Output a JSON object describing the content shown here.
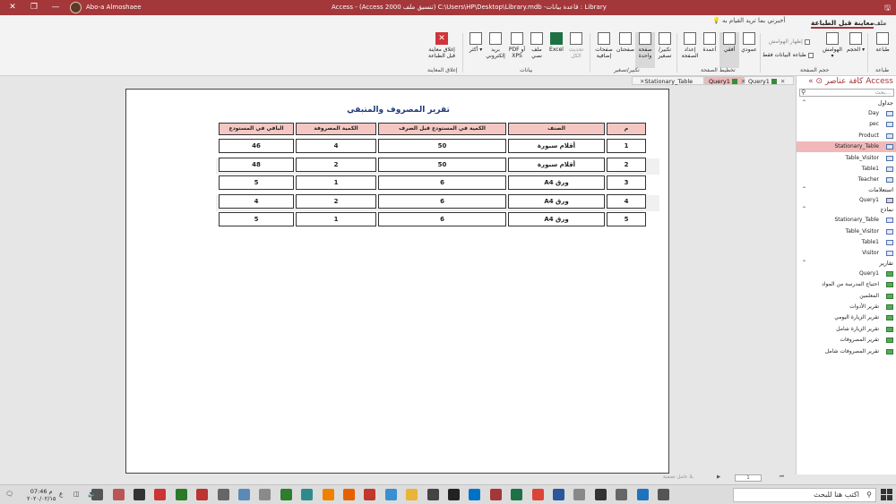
{
  "window": {
    "title": "Library : قاعدة بيانات- C:\\Users\\HP\\Desktop\\Library.mdb (تنسيق ملف Access 2000) - Access",
    "user": "Abo-a Almoshaee",
    "qa_icon": "save-icon"
  },
  "ribbon_tabs": {
    "file": "ملف",
    "print_preview": "معاينة قبل الطباعة",
    "tell_me": "أخبرني بما تريد القيام به"
  },
  "ribbon": {
    "print": "طباعة",
    "size": "الحجم",
    "margins": "الهوامش",
    "show_margins": "إظهار الهوامش",
    "print_data_only": "طباعة البيانات فقط",
    "portrait": "عمودي",
    "landscape": "أفقي",
    "columns": "أعمدة",
    "page_setup": "إعداد الصفحة",
    "zoom": "تكبير/ تصغير",
    "one_page": "صفحة واحدة",
    "two_pages": "صفحتان",
    "more_pages": "صفحات إضافية",
    "refresh_all": "تحديث الكل",
    "excel": "Excel",
    "text_file": "ملف نصي",
    "pdf_xps": "PDF أو XPS",
    "email": "بريد إلكتروني",
    "more": "أكثر",
    "close_preview": "إغلاق معاينة قبل الطباعة",
    "group_print": "طباعة",
    "group_page_size": "حجم الصفحة",
    "group_page_layout": "تخطيط الصفحة",
    "group_zoom": "تكبير/تصغير",
    "group_data": "بيانات",
    "group_close": "إغلاق المعاينة"
  },
  "doc_tabs": [
    {
      "label": "Query1"
    },
    {
      "label": "Query1"
    },
    {
      "label": "Stationary_Table"
    }
  ],
  "nav_pane": {
    "title": "كافة عناصر Access",
    "search_placeholder": "بحث...",
    "sections": {
      "tables": "جداول",
      "queries": "استعلامات",
      "forms": "نماذج",
      "reports": "تقارير"
    },
    "tables": [
      "Day",
      "pec",
      "Product",
      "Stationary_Table",
      "Table_Visitor",
      "Table1",
      "Teacher"
    ],
    "queries": [
      "Query1"
    ],
    "forms": [
      "Stationary_Table",
      "Table_Visitor",
      "Table1",
      "Visitor"
    ],
    "reports": [
      "Query1",
      "احتياج المدرسة من المواد",
      "المعلمين",
      "تقرير الأدوات",
      "تقرير الزيارة اليومي",
      "تقرير الزيارة شامل",
      "تقرير المصروفات",
      "تقرير المصروفات شامل"
    ]
  },
  "report": {
    "title": "تقرير المصروف والمتبقي",
    "headers": [
      "م",
      "الصنف",
      "الكمية في المستودع قبل الصرف",
      "الكمية المصروفة",
      "الباقي في المستودع"
    ],
    "rows": [
      [
        "1",
        "أقلام سبورة",
        "50",
        "4",
        "46"
      ],
      [
        "2",
        "أقلام سبورة",
        "50",
        "2",
        "48"
      ],
      [
        "3",
        "ورق A4",
        "6",
        "1",
        "5"
      ],
      [
        "4",
        "ورق A4",
        "6",
        "2",
        "4"
      ],
      [
        "5",
        "ورق A4",
        "6",
        "1",
        "5"
      ]
    ]
  },
  "status": {
    "page": "1",
    "filter": "بلا عامل تصفية"
  },
  "taskbar": {
    "search_placeholder": "اكتب هنا للبحث",
    "time": "م 07:46",
    "date": "٢٠٢٠/٠٢/١٥"
  }
}
